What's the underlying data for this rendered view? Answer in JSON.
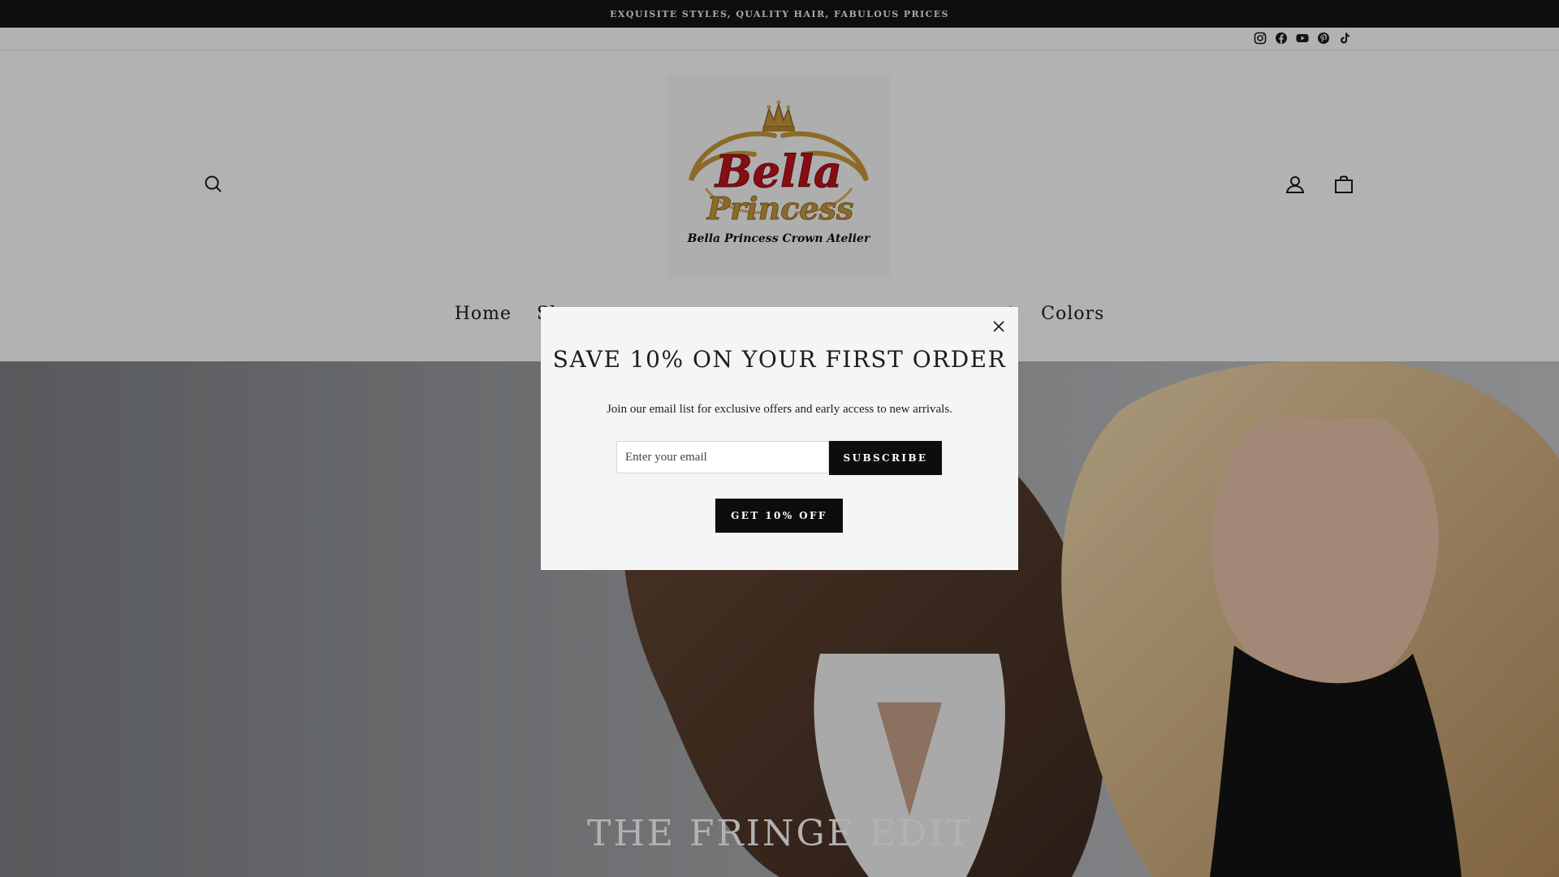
{
  "announcement": {
    "text": "EXQUISITE STYLES, QUALITY HAIR, FABULOUS PRICES"
  },
  "social": [
    {
      "name": "instagram-icon"
    },
    {
      "name": "facebook-icon"
    },
    {
      "name": "youtube-icon"
    },
    {
      "name": "pinterest-icon"
    },
    {
      "name": "tiktok-icon"
    }
  ],
  "header": {
    "logo": {
      "line1": "Bella",
      "line2": "Princess",
      "tagline": "Bella Princess Crown Atelier"
    },
    "icons": [
      "search-icon",
      "user-icon",
      "bag-icon"
    ]
  },
  "nav": {
    "items": [
      {
        "label": "Home"
      },
      {
        "label": "Sh"
      },
      {
        "label": "t"
      },
      {
        "label": "Colors"
      }
    ]
  },
  "hero": {
    "title": "THE FRINGE EDIT"
  },
  "popup": {
    "title": "SAVE 10% ON YOUR FIRST ORDER",
    "text": "Join our email list for exclusive offers and early access to new arrivals.",
    "email_placeholder": "Enter your email",
    "subscribe_label": "SUBSCRIBE",
    "discount_label": "GET 10% OFF"
  },
  "colors": {
    "announcement_bg": "#151515",
    "button_bg": "#0d0d0d",
    "overlay": "rgba(0,0,0,0.3)",
    "logo_red": "#c0141e",
    "logo_gold": "#c99a3a"
  }
}
